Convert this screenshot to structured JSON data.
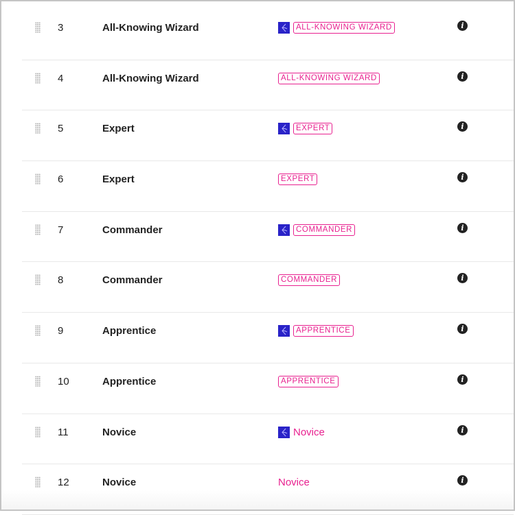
{
  "rows": [
    {
      "num": "3",
      "name": "All-Knowing Wizard",
      "rank": "ALL-KNOWING WIZARD",
      "logo": true,
      "style": "badge"
    },
    {
      "num": "4",
      "name": "All-Knowing Wizard",
      "rank": "ALL-KNOWING WIZARD",
      "logo": false,
      "style": "badge"
    },
    {
      "num": "5",
      "name": "Expert",
      "rank": "EXPERT",
      "logo": true,
      "style": "badge"
    },
    {
      "num": "6",
      "name": "Expert",
      "rank": "EXPERT",
      "logo": false,
      "style": "badge"
    },
    {
      "num": "7",
      "name": "Commander",
      "rank": "COMMANDER",
      "logo": true,
      "style": "badge"
    },
    {
      "num": "8",
      "name": "Commander",
      "rank": "COMMANDER",
      "logo": false,
      "style": "badge"
    },
    {
      "num": "9",
      "name": "Apprentice",
      "rank": "APPRENTICE",
      "logo": true,
      "style": "badge"
    },
    {
      "num": "10",
      "name": "Apprentice",
      "rank": "APPRENTICE",
      "logo": false,
      "style": "badge"
    },
    {
      "num": "11",
      "name": "Novice",
      "rank": "Novice",
      "logo": true,
      "style": "plain"
    },
    {
      "num": "12",
      "name": "Novice",
      "rank": "Novice",
      "logo": false,
      "style": "plain"
    }
  ],
  "colors": {
    "accent": "#e8208f",
    "logo": "#2a23c8"
  },
  "icons": {
    "info": "i"
  }
}
